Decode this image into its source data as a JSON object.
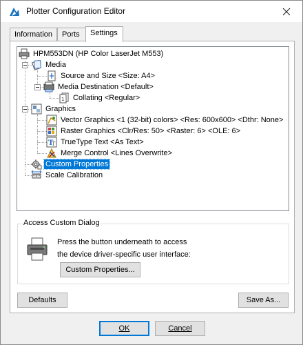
{
  "window": {
    "title": "Plotter Configuration Editor"
  },
  "tabs": [
    {
      "label": "Information"
    },
    {
      "label": "Ports"
    },
    {
      "label": "Settings"
    }
  ],
  "tree": {
    "root": "HPM553DN (HP Color LaserJet M553)",
    "media": "Media",
    "source_size": "Source and Size <Size: A4>",
    "media_destination": "Media Destination <Default>",
    "collating": "Collating <Regular>",
    "graphics": "Graphics",
    "vector_graphics": "Vector Graphics <1 (32-bit) colors> <Res: 600x600> <Dthr: None>",
    "raster_graphics": "Raster Graphics <Clr/Res: 50> <Raster: 6> <OLE: 6>",
    "truetype_text": "TrueType Text <As Text>",
    "merge_control": "Merge Control <Lines Overwrite>",
    "custom_properties": "Custom Properties",
    "scale_calibration": "Scale Calibration"
  },
  "group": {
    "title": "Access Custom Dialog",
    "line1": "Press the button underneath to access",
    "line2": "the device driver-specific user interface:",
    "button": "Custom Properties..."
  },
  "buttons": {
    "defaults": "Defaults",
    "save_as": "Save As...",
    "ok": "OK",
    "cancel": "Cancel"
  },
  "colors": {
    "selection": "#0078d7",
    "accent": "#0078d7"
  }
}
